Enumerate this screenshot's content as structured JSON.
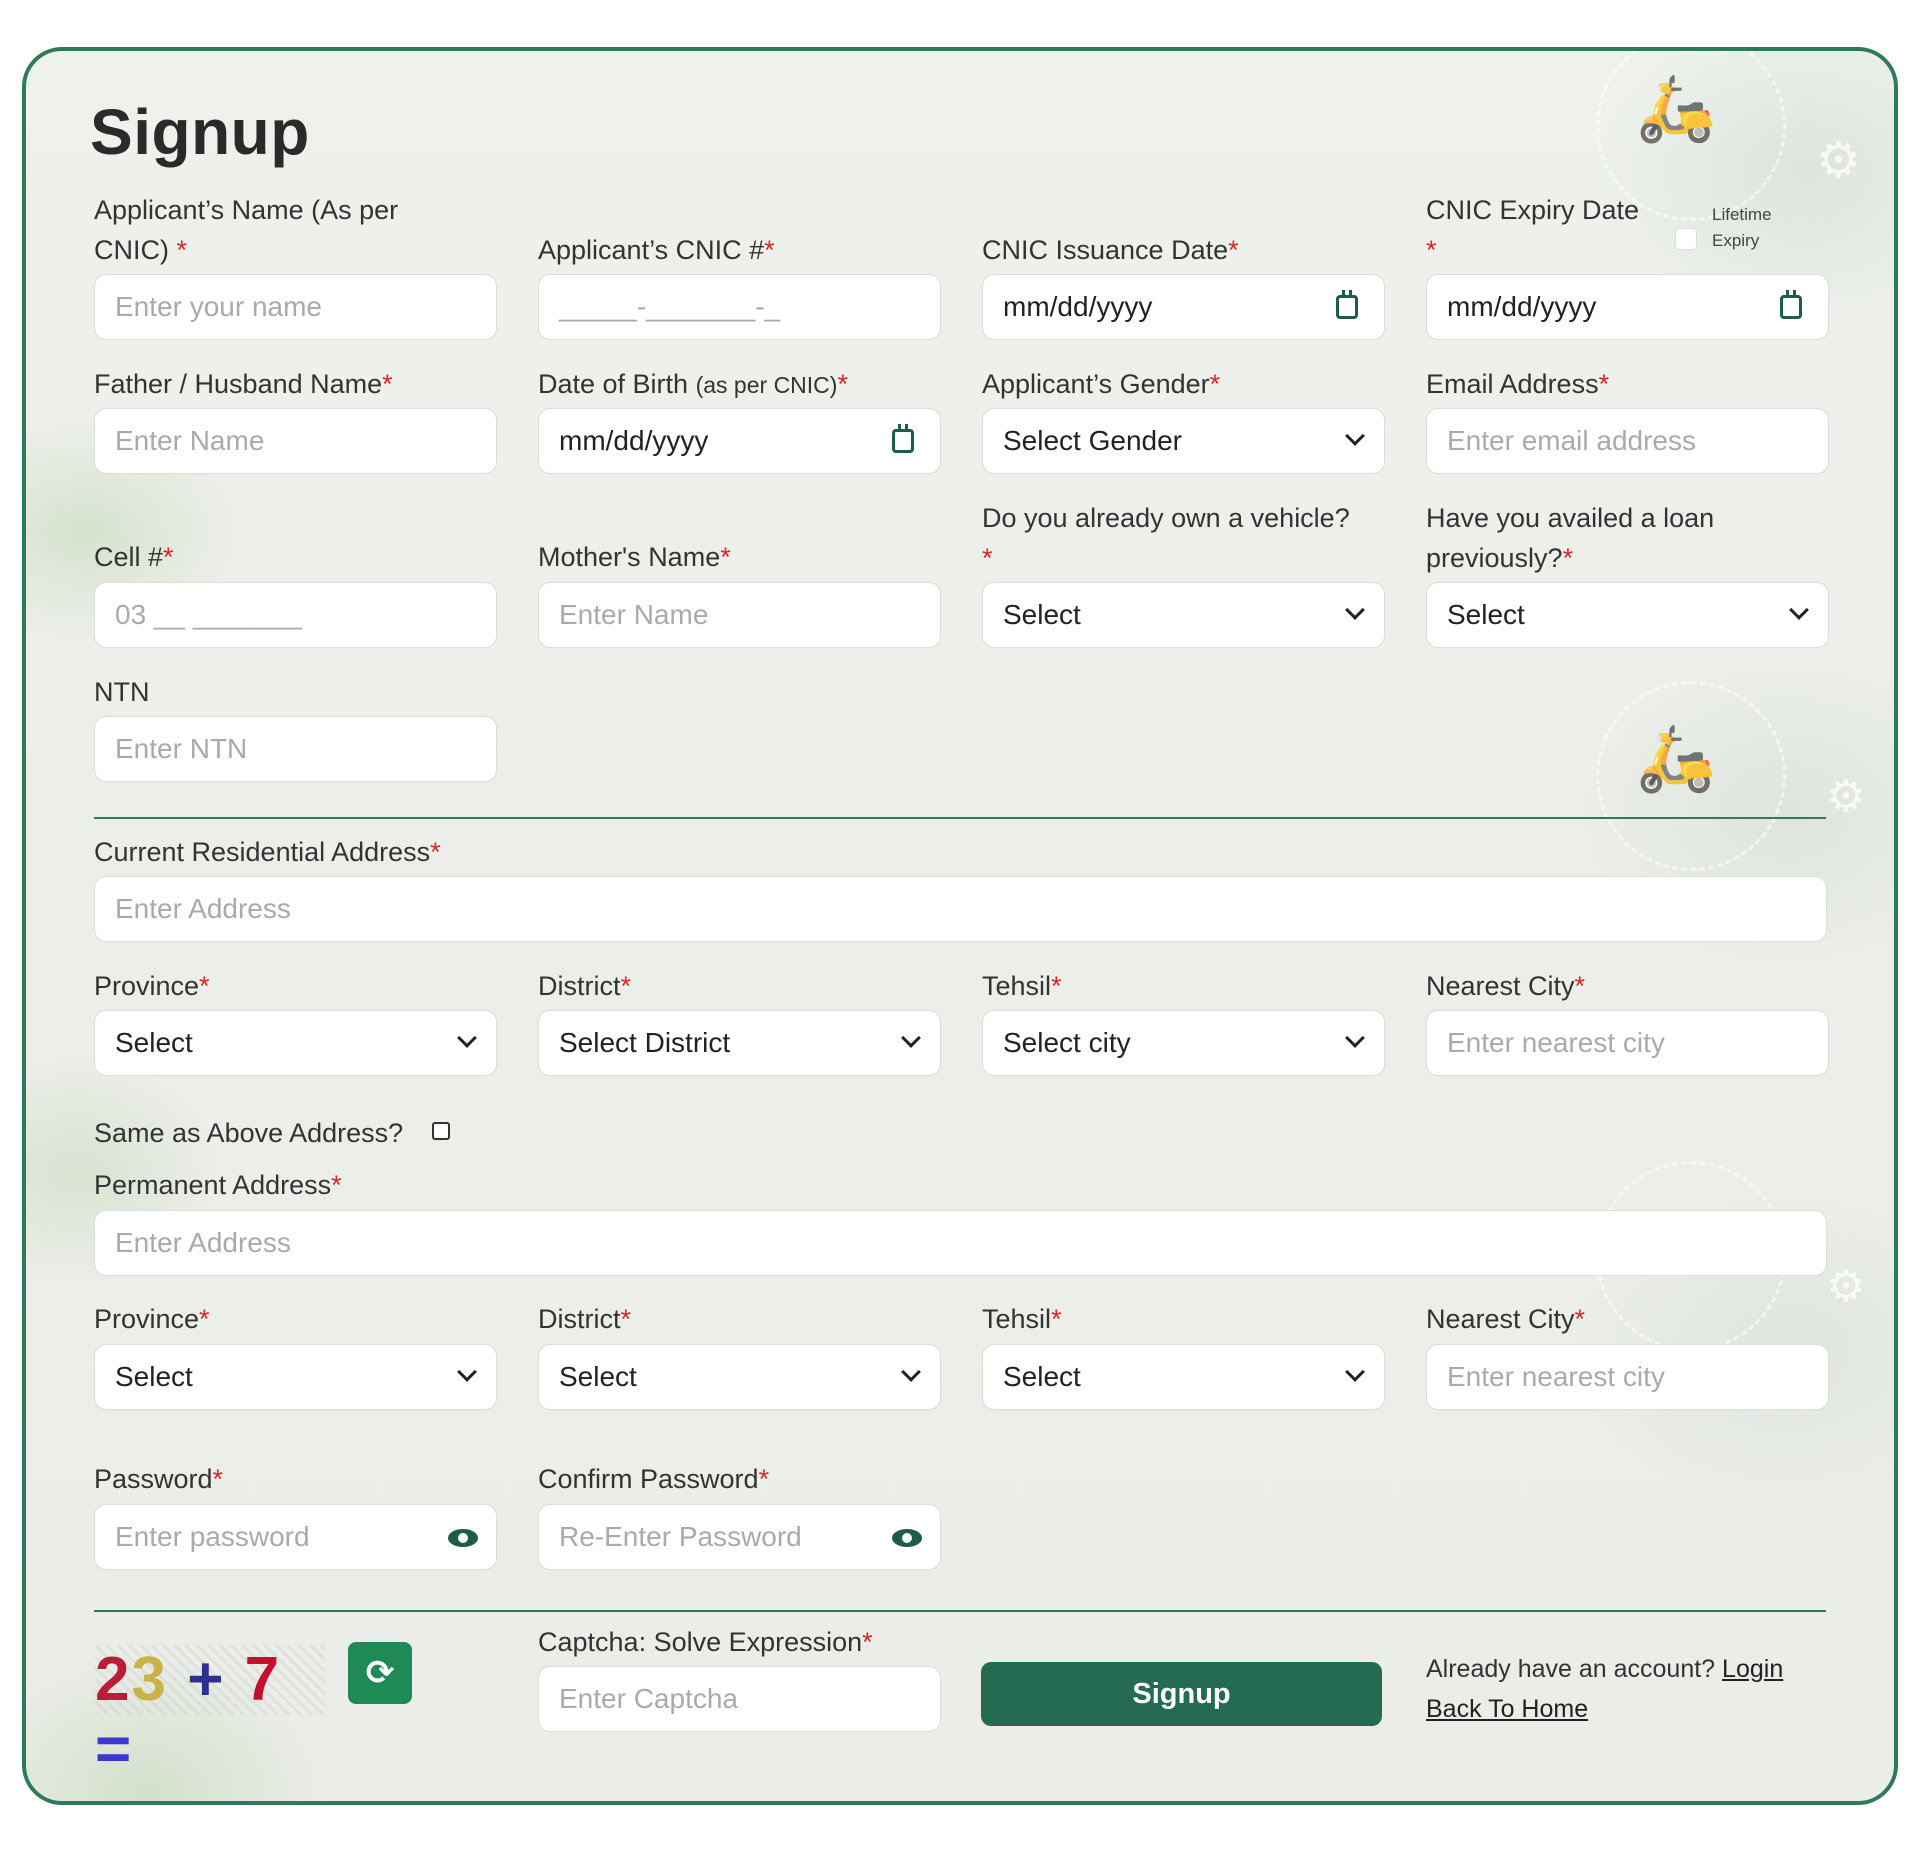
{
  "title": "Signup",
  "fields": {
    "name": {
      "label": "Applicant’s Name (As per",
      "label2": "CNIC)",
      "placeholder": "Enter your name"
    },
    "cnic": {
      "label": "Applicant’s CNIC #",
      "placeholder": "_____-_______-_"
    },
    "issuance": {
      "label": "CNIC Issuance Date",
      "value": "mm/dd/yyyy"
    },
    "expiry": {
      "label": "CNIC Expiry Date",
      "value": "mm/dd/yyyy",
      "lifetime1": "Lifetime",
      "lifetime2": "Expiry"
    },
    "father": {
      "label": "Father / Husband Name",
      "placeholder": "Enter Name"
    },
    "dob": {
      "label": "Date of Birth",
      "label_small": "(as per CNIC)",
      "value": "mm/dd/yyyy"
    },
    "gender": {
      "label": "Applicant’s Gender",
      "value": "Select Gender"
    },
    "email": {
      "label": "Email Address",
      "placeholder": "Enter email address"
    },
    "vehicle": {
      "label": "Do you already own a vehicle?",
      "value": "Select"
    },
    "loan": {
      "label": "Have you availed a loan",
      "label2": "previously?",
      "value": "Select"
    },
    "cell": {
      "label": "Cell #",
      "placeholder": "03 __ _______"
    },
    "mother": {
      "label": "Mother's Name",
      "placeholder": "Enter Name"
    },
    "ntn": {
      "label": "NTN",
      "placeholder": "Enter NTN"
    },
    "current_address": {
      "label": "Current Residential Address",
      "placeholder": "Enter Address"
    },
    "cur_province": {
      "label": "Province",
      "value": "Select"
    },
    "cur_district": {
      "label": "District",
      "value": "Select District"
    },
    "cur_tehsil": {
      "label": "Tehsil",
      "value": "Select city"
    },
    "cur_city": {
      "label": "Nearest City",
      "placeholder": "Enter nearest city"
    },
    "same_as_above": {
      "label": "Same as Above Address?"
    },
    "perm_address": {
      "label": "Permanent Address",
      "placeholder": "Enter Address"
    },
    "perm_province": {
      "label": "Province",
      "value": "Select"
    },
    "perm_district": {
      "label": "District",
      "value": "Select"
    },
    "perm_tehsil": {
      "label": "Tehsil",
      "value": "Select"
    },
    "perm_city": {
      "label": "Nearest City",
      "placeholder": "Enter nearest city"
    },
    "password": {
      "label": "Password",
      "placeholder": "Enter password"
    },
    "confirm": {
      "label": "Confirm Password",
      "placeholder": "Re-Enter Password"
    },
    "captcha": {
      "label": "Captcha: Solve Expression",
      "placeholder": "Enter Captcha"
    }
  },
  "required_mark": "*",
  "captcha_image": {
    "d1": "2",
    "d2": "3",
    "op": "+",
    "d3": "7",
    "eq": "="
  },
  "refresh_icon": "refresh-icon",
  "signup_button": "Signup",
  "account_text": "Already have an account?",
  "login_link": "Login",
  "home_link": "Back To Home"
}
